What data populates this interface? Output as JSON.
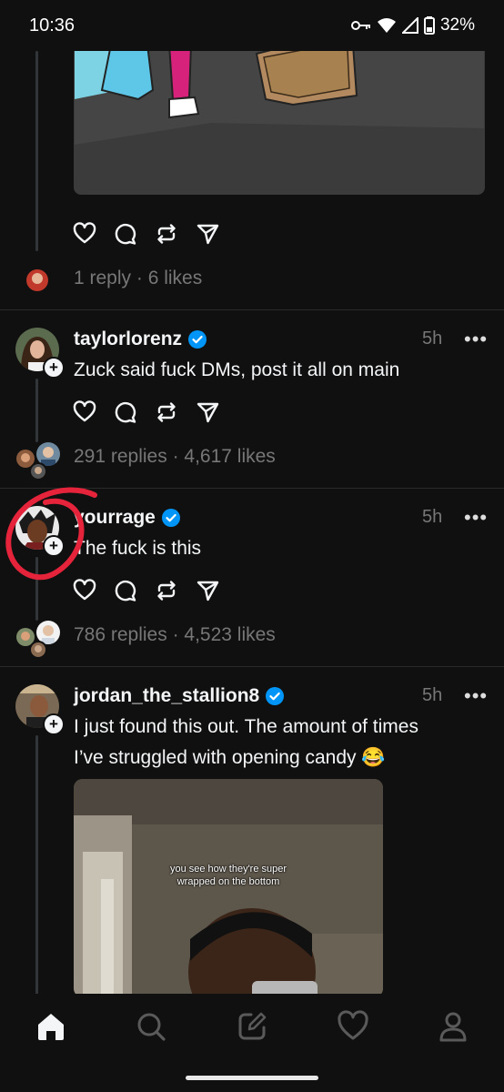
{
  "status_bar": {
    "time": "10:36",
    "battery": "32%"
  },
  "prev_post": {
    "stats": "1 reply · 6 likes"
  },
  "posts": [
    {
      "username": "taylorlorenz",
      "time": "5h",
      "text": "Zuck said fuck DMs, post it all on main",
      "stats": "291 replies · 4,617 likes"
    },
    {
      "username": "yourrage",
      "time": "5h",
      "text": "The fuck is this",
      "stats": "786 replies · 4,523 likes"
    },
    {
      "username": "jordan_the_stallion8",
      "time": "5h",
      "text_line1": "I just found this out. The amount of times",
      "text_line2": "I’ve struggled with opening candy 😂",
      "video_caption_line1": "you see how they're super",
      "video_caption_line2": "wrapped on the bottom"
    }
  ],
  "nav": [
    "home-icon",
    "search-icon",
    "compose-icon",
    "activity-heart-icon",
    "profile-icon"
  ],
  "colors": {
    "background": "#101010",
    "verified": "#0095f6",
    "annotation": "#e5243b",
    "muted": "#777777"
  }
}
